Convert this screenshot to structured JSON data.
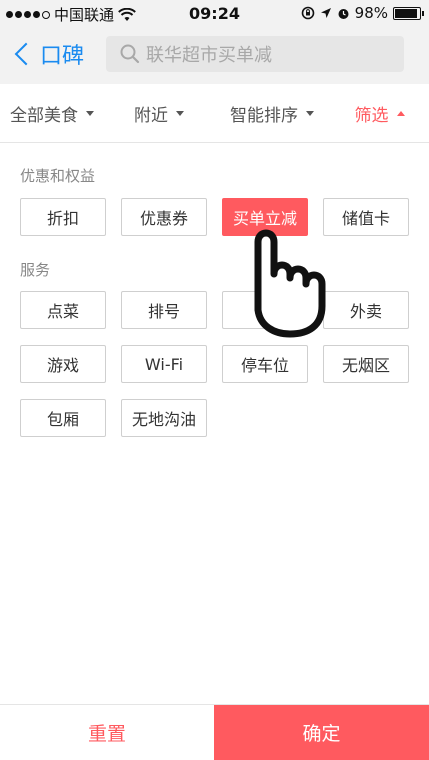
{
  "status_bar": {
    "carrier": "中国联通",
    "time": "09:24",
    "battery": "98%",
    "signal_icon": "signal-dots-icon",
    "wifi_icon": "wifi-icon",
    "rotation_lock_icon": "rotation-lock-icon",
    "location_icon": "location-arrow-icon",
    "alarm_icon": "alarm-icon",
    "battery_icon": "battery-icon"
  },
  "nav": {
    "back_label": "口碑",
    "search_placeholder": "联华超市买单减"
  },
  "filter_bar": {
    "items": [
      {
        "label": "全部美食",
        "active": false
      },
      {
        "label": "附近",
        "active": false
      },
      {
        "label": "智能排序",
        "active": false
      },
      {
        "label": "筛选",
        "active": true
      }
    ]
  },
  "sections": [
    {
      "title": "优惠和权益",
      "tags": [
        {
          "label": "折扣",
          "selected": false
        },
        {
          "label": "优惠券",
          "selected": false
        },
        {
          "label": "买单立减",
          "selected": true
        },
        {
          "label": "储值卡",
          "selected": false
        }
      ]
    },
    {
      "title": "服务",
      "tags": [
        {
          "label": "点菜",
          "selected": false
        },
        {
          "label": "排号",
          "selected": false
        },
        {
          "label": "预",
          "selected": false
        },
        {
          "label": "外卖",
          "selected": false
        },
        {
          "label": "游戏",
          "selected": false
        },
        {
          "label": "Wi-Fi",
          "selected": false
        },
        {
          "label": "停车位",
          "selected": false
        },
        {
          "label": "无烟区",
          "selected": false
        },
        {
          "label": "包厢",
          "selected": false
        },
        {
          "label": "无地沟油",
          "selected": false
        }
      ]
    }
  ],
  "bottom_bar": {
    "reset_label": "重置",
    "confirm_label": "确定"
  },
  "colors": {
    "accent": "#ff5a5f",
    "link_blue": "#1a8bf0"
  }
}
